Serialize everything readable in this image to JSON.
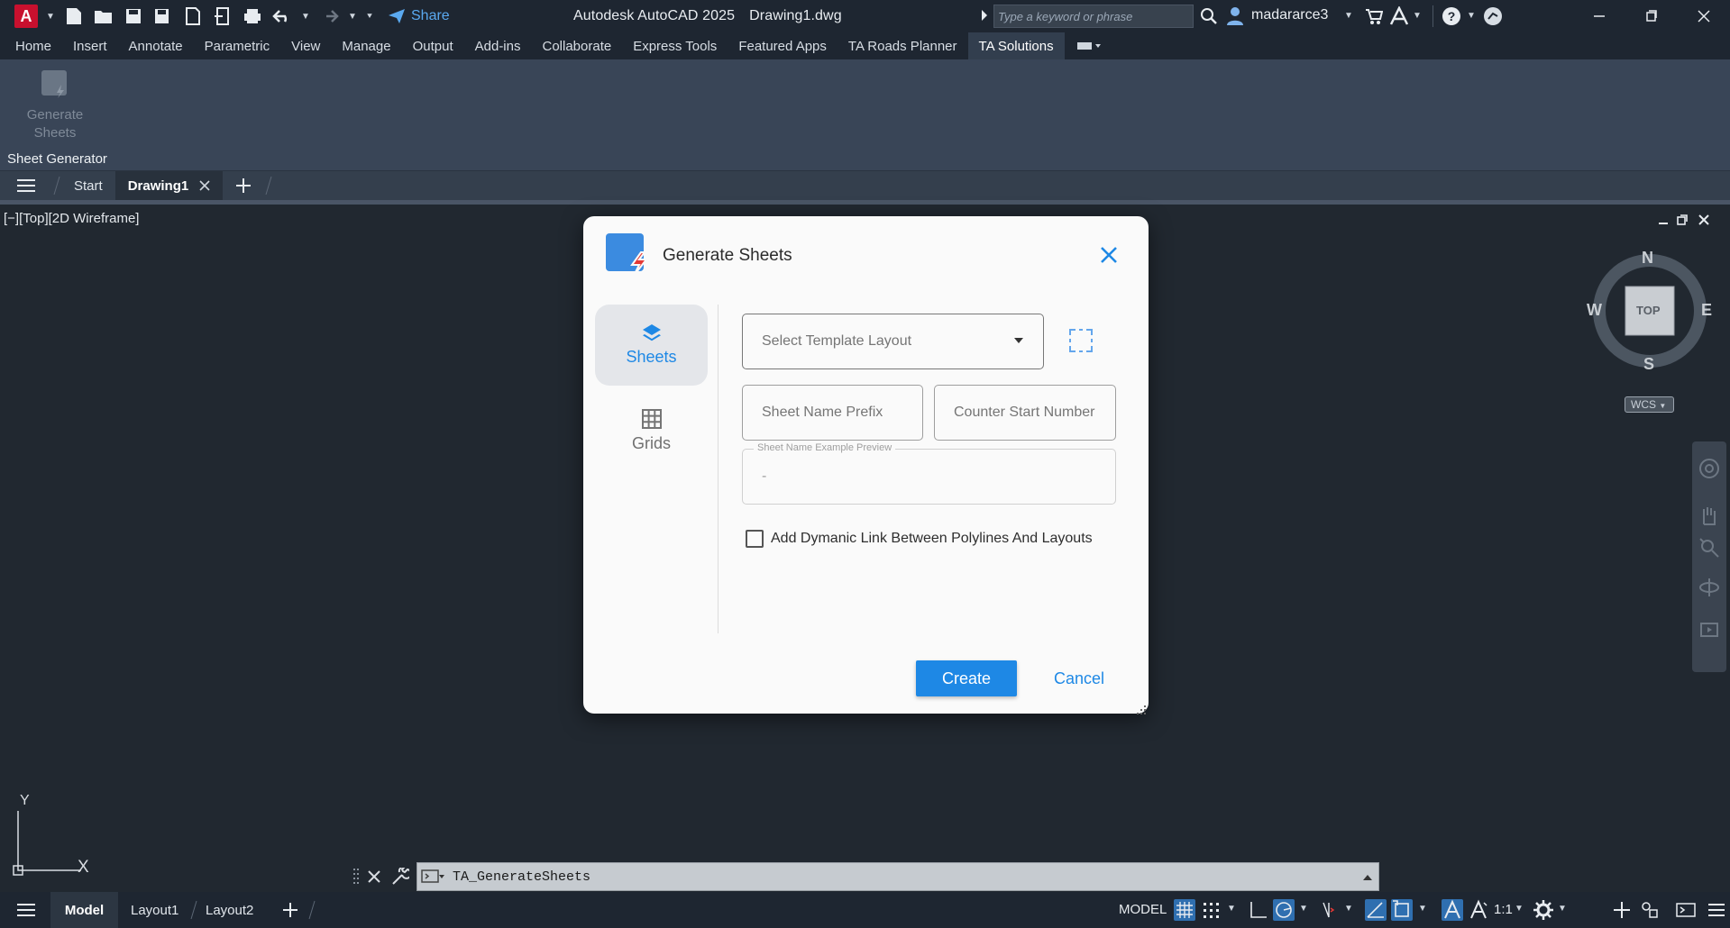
{
  "app": {
    "product": "Autodesk AutoCAD 2025",
    "file": "Drawing1.dwg",
    "logo_letter": "A",
    "accent": "#e8112d"
  },
  "qat": {
    "share_label": "Share"
  },
  "search": {
    "placeholder": "Type a keyword or phrase"
  },
  "user": {
    "name": "madararce3"
  },
  "ribbon_tabs": [
    "Home",
    "Insert",
    "Annotate",
    "Parametric",
    "View",
    "Manage",
    "Output",
    "Add-ins",
    "Collaborate",
    "Express Tools",
    "Featured Apps",
    "TA Roads Planner",
    "TA Solutions"
  ],
  "ribbon_active": "TA Solutions",
  "ribbon": {
    "button_label_1": "Generate",
    "button_label_2": "Sheets",
    "panel_title": "Sheet Generator"
  },
  "doc_tabs": {
    "start": "Start",
    "active": "Drawing1"
  },
  "viewport": {
    "label": "[−][Top][2D Wireframe]"
  },
  "navcube": {
    "n": "N",
    "s": "S",
    "e": "E",
    "w": "W",
    "face": "TOP",
    "wcs": "WCS"
  },
  "ucs": {
    "x": "X",
    "y": "Y"
  },
  "dialog": {
    "title": "Generate Sheets",
    "nav": [
      {
        "label": "Sheets",
        "active": true
      },
      {
        "label": "Grids",
        "active": false
      }
    ],
    "template_placeholder": "Select Template Layout",
    "prefix_placeholder": "Sheet Name Prefix",
    "counter_placeholder": "Counter Start Number",
    "preview_label": "Sheet Name Example Preview",
    "preview_value": "-",
    "checkbox_label": "Add Dymanic Link Between Polylines And Layouts",
    "checkbox_checked": false,
    "create_label": "Create",
    "cancel_label": "Cancel",
    "accent": "#1e88e5"
  },
  "command": {
    "text": "TA_GenerateSheets"
  },
  "layout_tabs": [
    "Model",
    "Layout1",
    "Layout2"
  ],
  "status": {
    "model_label": "MODEL",
    "scale": "1:1"
  }
}
